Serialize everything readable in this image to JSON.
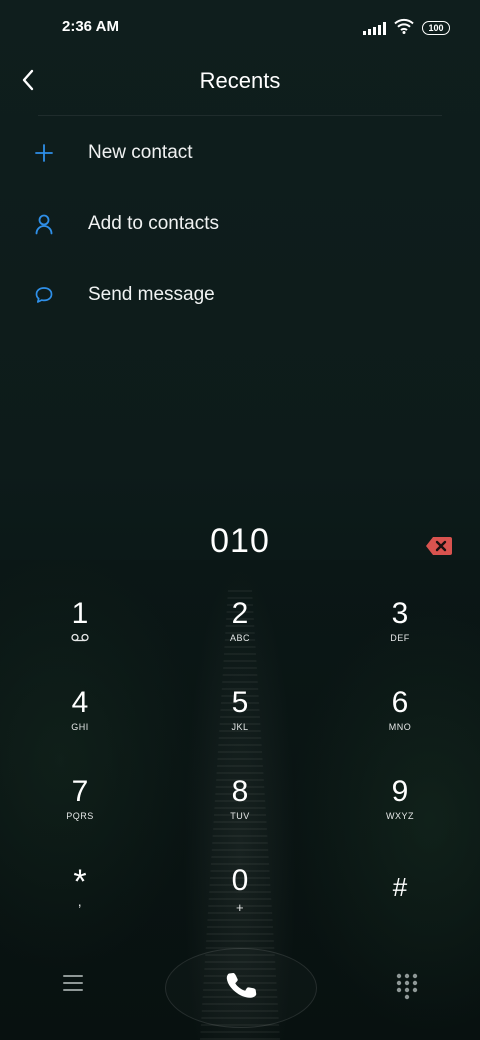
{
  "status_bar": {
    "time": "2:36 AM",
    "battery": "100"
  },
  "header": {
    "title": "Recents",
    "back_icon": "chevron-left-icon"
  },
  "actions": [
    {
      "label": "New contact",
      "icon": "plus-icon",
      "color": "#2f8fe8"
    },
    {
      "label": "Add to contacts",
      "icon": "person-icon",
      "color": "#2f8fe8"
    },
    {
      "label": "Send message",
      "icon": "message-bubble-icon",
      "color": "#2f8fe8"
    }
  ],
  "dialer": {
    "number": "010",
    "backspace_color": "#d9534f"
  },
  "keypad": [
    {
      "digit": "1",
      "letters": ""
    },
    {
      "digit": "2",
      "letters": "ABC"
    },
    {
      "digit": "3",
      "letters": "DEF"
    },
    {
      "digit": "4",
      "letters": "GHI"
    },
    {
      "digit": "5",
      "letters": "JKL"
    },
    {
      "digit": "6",
      "letters": "MNO"
    },
    {
      "digit": "7",
      "letters": "PQRS"
    },
    {
      "digit": "8",
      "letters": "TUV"
    },
    {
      "digit": "9",
      "letters": "WXYZ"
    },
    {
      "digit": "*",
      "letters": ","
    },
    {
      "digit": "0",
      "letters": "+"
    },
    {
      "digit": "#",
      "letters": ""
    }
  ],
  "bottom_bar": {
    "menu_icon": "hamburger-menu-icon",
    "call_icon": "phone-icon",
    "dialpad_icon": "dialpad-icon"
  }
}
